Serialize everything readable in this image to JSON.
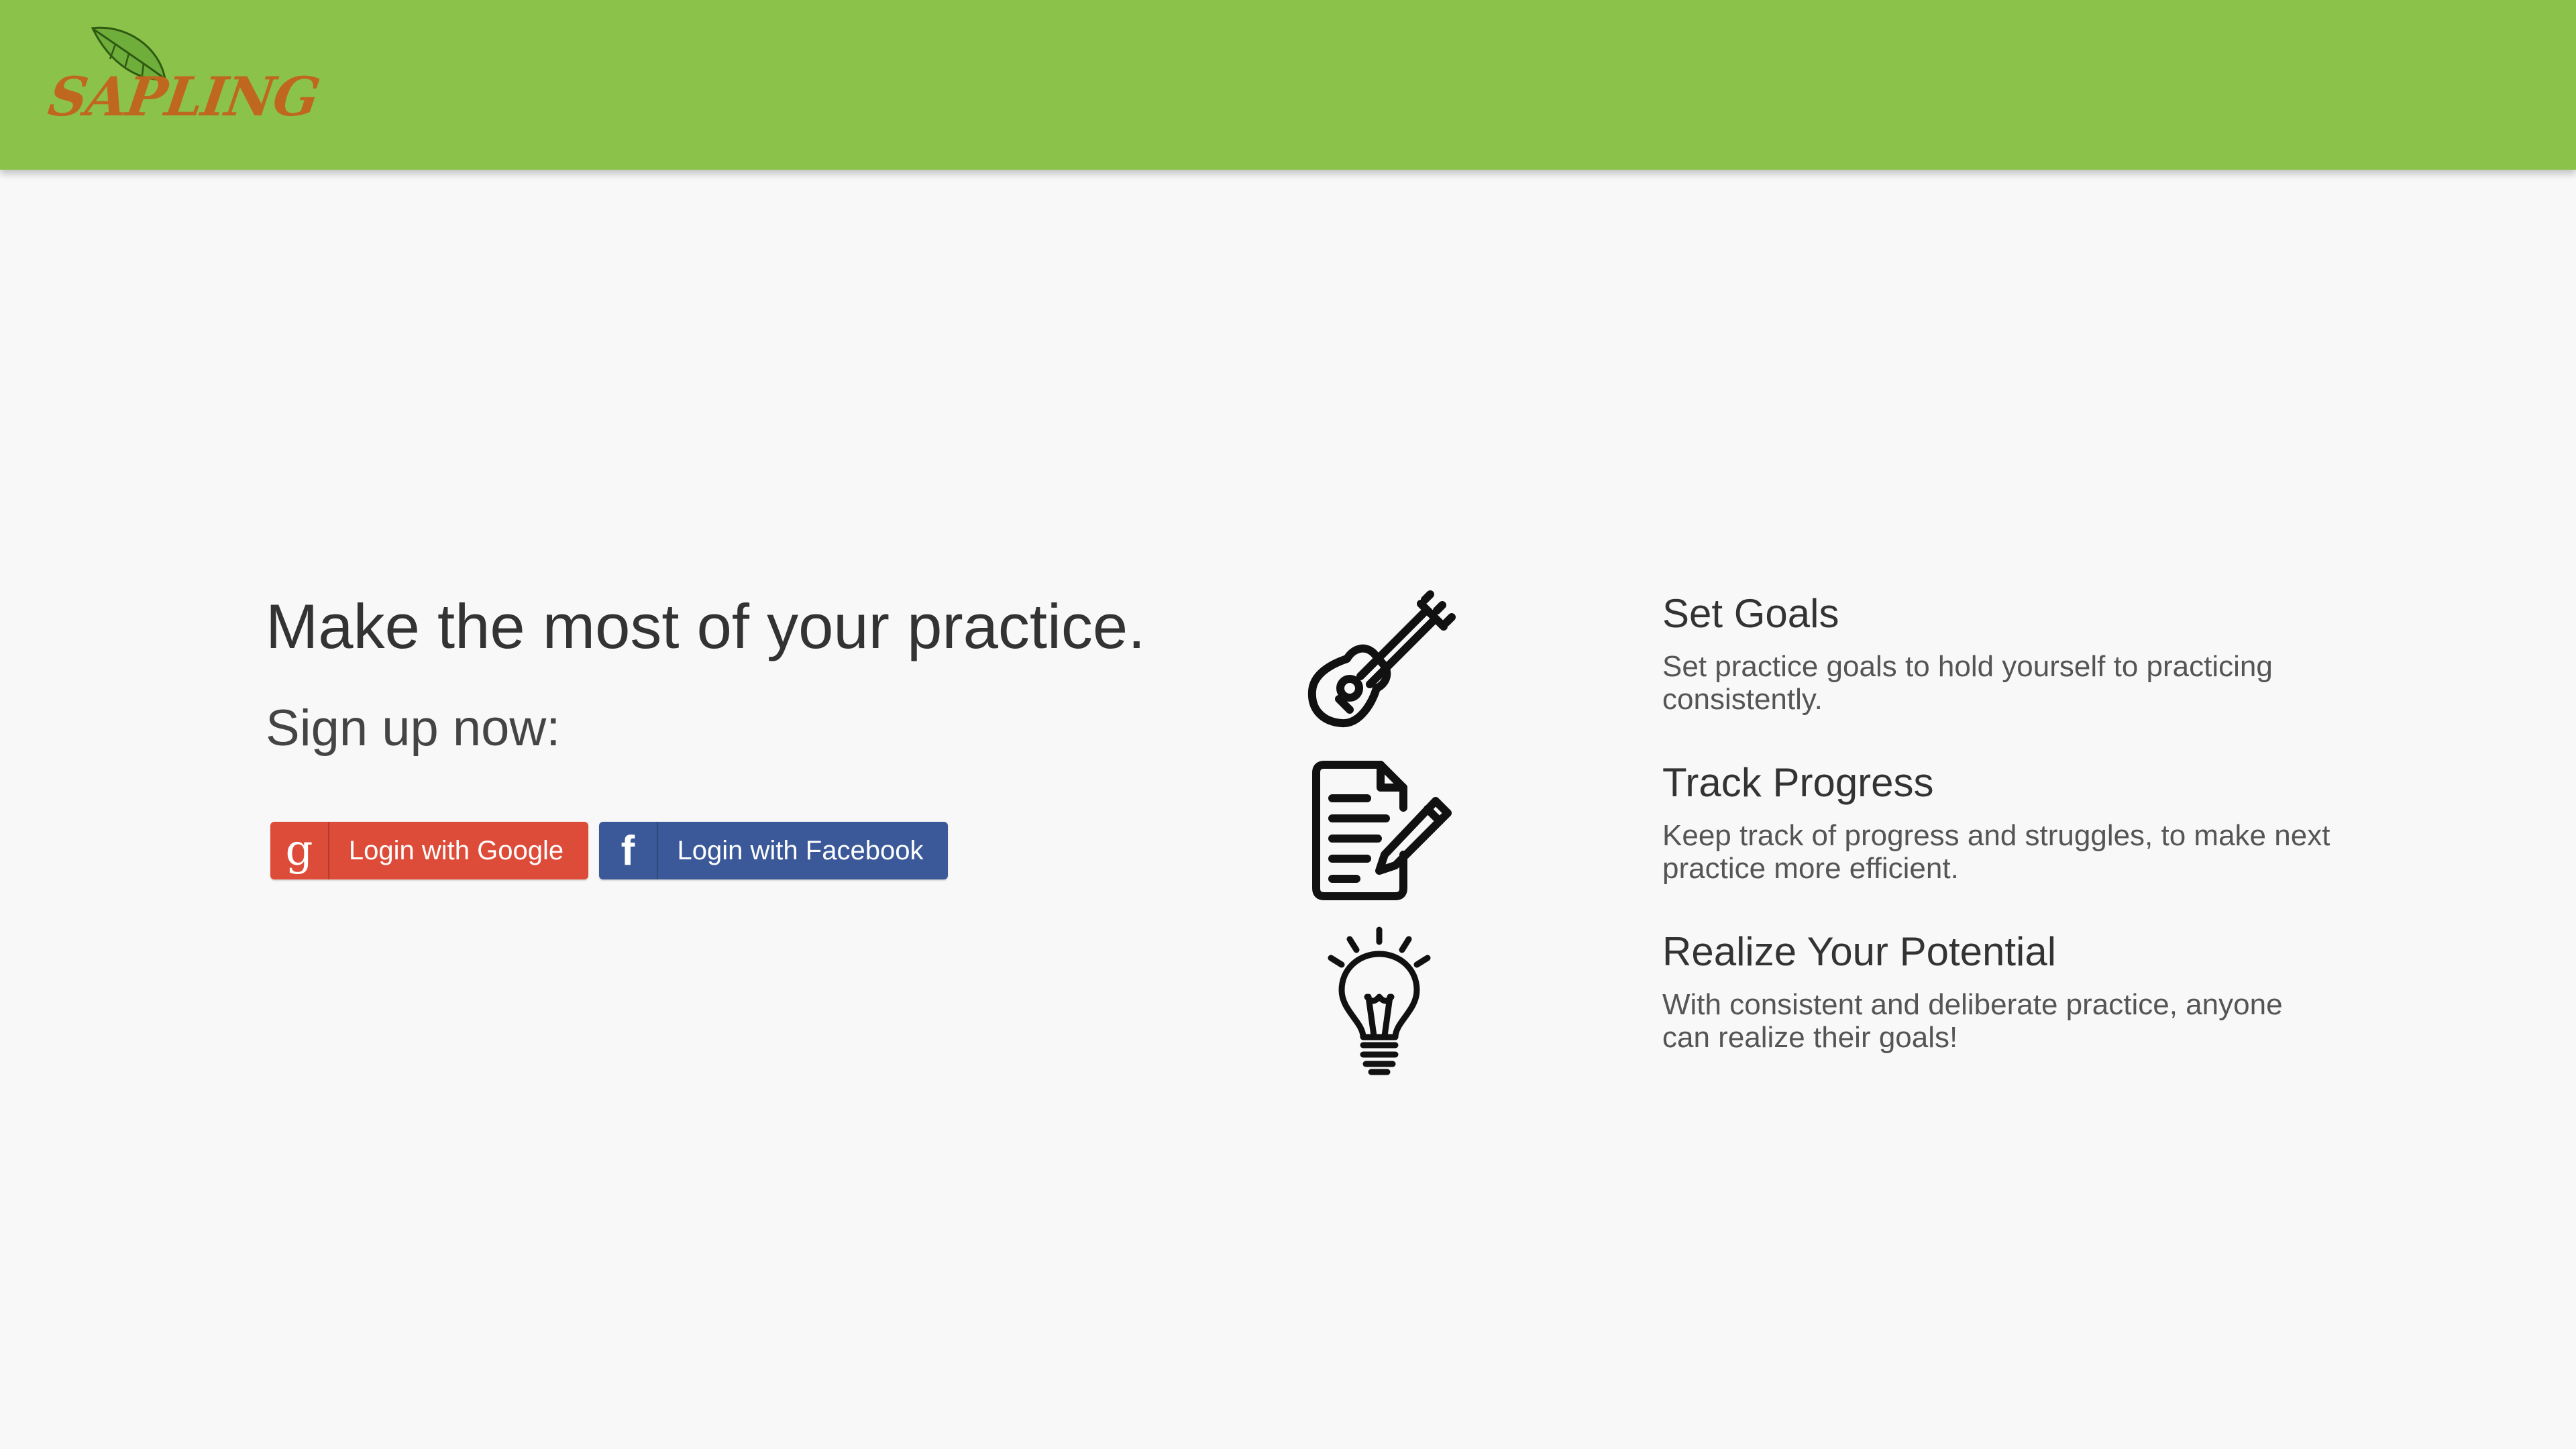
{
  "header": {
    "logo_text": "SAPLING",
    "brand_color": "#8bc34a",
    "logo_text_color": "#c0671f"
  },
  "hero": {
    "title": "Make the most of your practice.",
    "subtitle": "Sign up now:",
    "buttons": [
      {
        "label": "Login with Google",
        "icon": "google-icon",
        "color": "#dd4b39"
      },
      {
        "label": "Login with Facebook",
        "icon": "facebook-icon",
        "color": "#3b5998"
      }
    ]
  },
  "features": [
    {
      "icon": "guitar-icon",
      "title": "Set Goals",
      "description": "Set practice goals to hold yourself to practicing consistently."
    },
    {
      "icon": "document-pencil-icon",
      "title": "Track Progress",
      "description": "Keep track of progress and struggles, to make next practice more efficient."
    },
    {
      "icon": "lightbulb-icon",
      "title": "Realize Your Potential",
      "description": "With consistent and deliberate practice, anyone can realize their goals!"
    }
  ]
}
